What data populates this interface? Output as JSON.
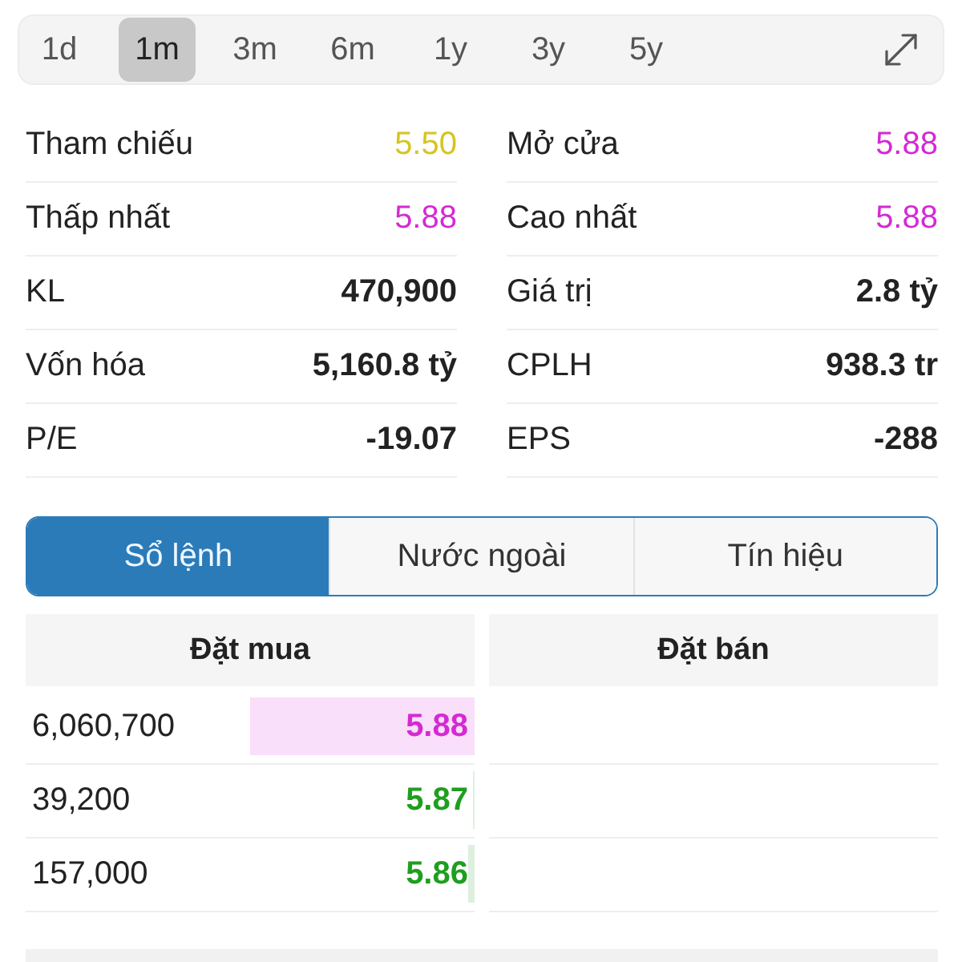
{
  "periods": [
    {
      "label": "1d",
      "selected": false
    },
    {
      "label": "1m",
      "selected": true
    },
    {
      "label": "3m",
      "selected": false
    },
    {
      "label": "6m",
      "selected": false
    },
    {
      "label": "1y",
      "selected": false
    },
    {
      "label": "3y",
      "selected": false
    },
    {
      "label": "5y",
      "selected": false
    }
  ],
  "stats": [
    {
      "label": "Tham chiếu",
      "value": "5.50",
      "color": "#d6c520"
    },
    {
      "label": "Mở cửa",
      "value": "5.88",
      "color": "#d42ad4"
    },
    {
      "label": "Thấp nhất",
      "value": "5.88",
      "color": "#d42ad4"
    },
    {
      "label": "Cao nhất",
      "value": "5.88",
      "color": "#d42ad4"
    },
    {
      "label": "KL",
      "value": "470,900"
    },
    {
      "label": "Giá trị",
      "value": "2.8 tỷ"
    },
    {
      "label": "Vốn hóa",
      "value": "5,160.8 tỷ"
    },
    {
      "label": "CPLH",
      "value": "938.3 tr"
    },
    {
      "label": "P/E",
      "value": "-19.07"
    },
    {
      "label": "EPS",
      "value": "-288"
    }
  ],
  "tabs": [
    {
      "label": "Sổ lệnh",
      "selected": true
    },
    {
      "label": "Nước ngoài",
      "selected": false
    },
    {
      "label": "Tín hiệu",
      "selected": false
    }
  ],
  "order_book": {
    "columns": [
      "Đặt mua",
      "Đặt bán"
    ],
    "bids": [
      {
        "volume": "6,060,700",
        "price": "5.88",
        "color": "#d42ad4",
        "level": 0.5
      },
      {
        "volume": "39,200",
        "price": "5.87",
        "color": "#1f9e1f",
        "level": 0.004
      },
      {
        "volume": "157,000",
        "price": "5.86",
        "color": "#1f9e1f",
        "level": 0.013
      }
    ]
  }
}
